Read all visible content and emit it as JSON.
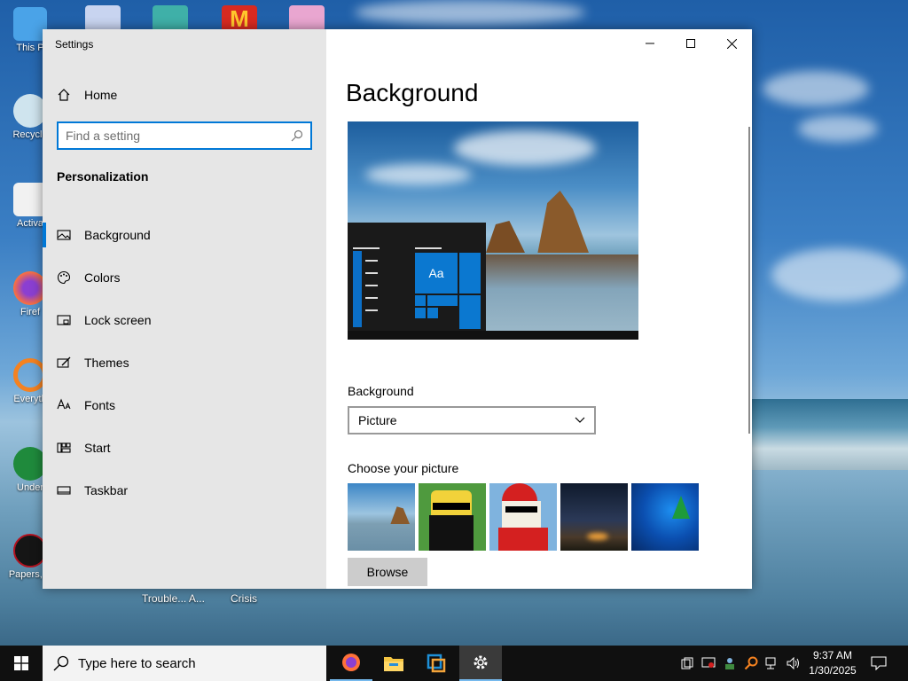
{
  "window": {
    "title": "Settings",
    "controls": {
      "minimize": "minimize",
      "maximize": "maximize",
      "close": "close"
    }
  },
  "sidebar": {
    "home_label": "Home",
    "search_placeholder": "Find a setting",
    "section_title": "Personalization",
    "items": [
      {
        "label": "Background",
        "icon": "picture-icon",
        "active": true
      },
      {
        "label": "Colors",
        "icon": "palette-icon",
        "active": false
      },
      {
        "label": "Lock screen",
        "icon": "lock-screen-icon",
        "active": false
      },
      {
        "label": "Themes",
        "icon": "themes-icon",
        "active": false
      },
      {
        "label": "Fonts",
        "icon": "fonts-icon",
        "active": false
      },
      {
        "label": "Start",
        "icon": "start-icon",
        "active": false
      },
      {
        "label": "Taskbar",
        "icon": "taskbar-icon",
        "active": false
      }
    ]
  },
  "main": {
    "title": "Background",
    "preview_tile_text": "Aa",
    "background_label": "Background",
    "background_value": "Picture",
    "choose_label": "Choose your picture",
    "pictures": [
      "beach-rock-picture",
      "cartoon-man-picture",
      "santa-cartoon-picture",
      "night-sky-picture",
      "windows-christmas-picture"
    ],
    "browse_label": "Browse"
  },
  "desktop": {
    "icons": [
      {
        "label": "This P",
        "name": "this-pc-icon"
      },
      {
        "label": "Recycle",
        "name": "recycle-bin-icon"
      },
      {
        "label": "Activa",
        "name": "activate-icon"
      },
      {
        "label": "Firef",
        "name": "firefox-desktop-icon"
      },
      {
        "label": "Everyth",
        "name": "everything-desktop-icon"
      },
      {
        "label": "Under",
        "name": "undertale-desktop-icon"
      },
      {
        "label": "Papers, P",
        "name": "papers-please-desktop-icon"
      }
    ],
    "below_labels": [
      "Trouble... A...",
      "Crisis"
    ]
  },
  "taskbar": {
    "search_placeholder": "Type here to search",
    "time": "9:37 AM",
    "date": "1/30/2025",
    "apps": [
      "firefox-icon",
      "file-explorer-icon",
      "virtualbox-icon",
      "settings-icon"
    ]
  },
  "colors": {
    "accent": "#0078d7",
    "sidebar_bg": "#e6e6e6",
    "taskbar_bg": "#101010"
  }
}
